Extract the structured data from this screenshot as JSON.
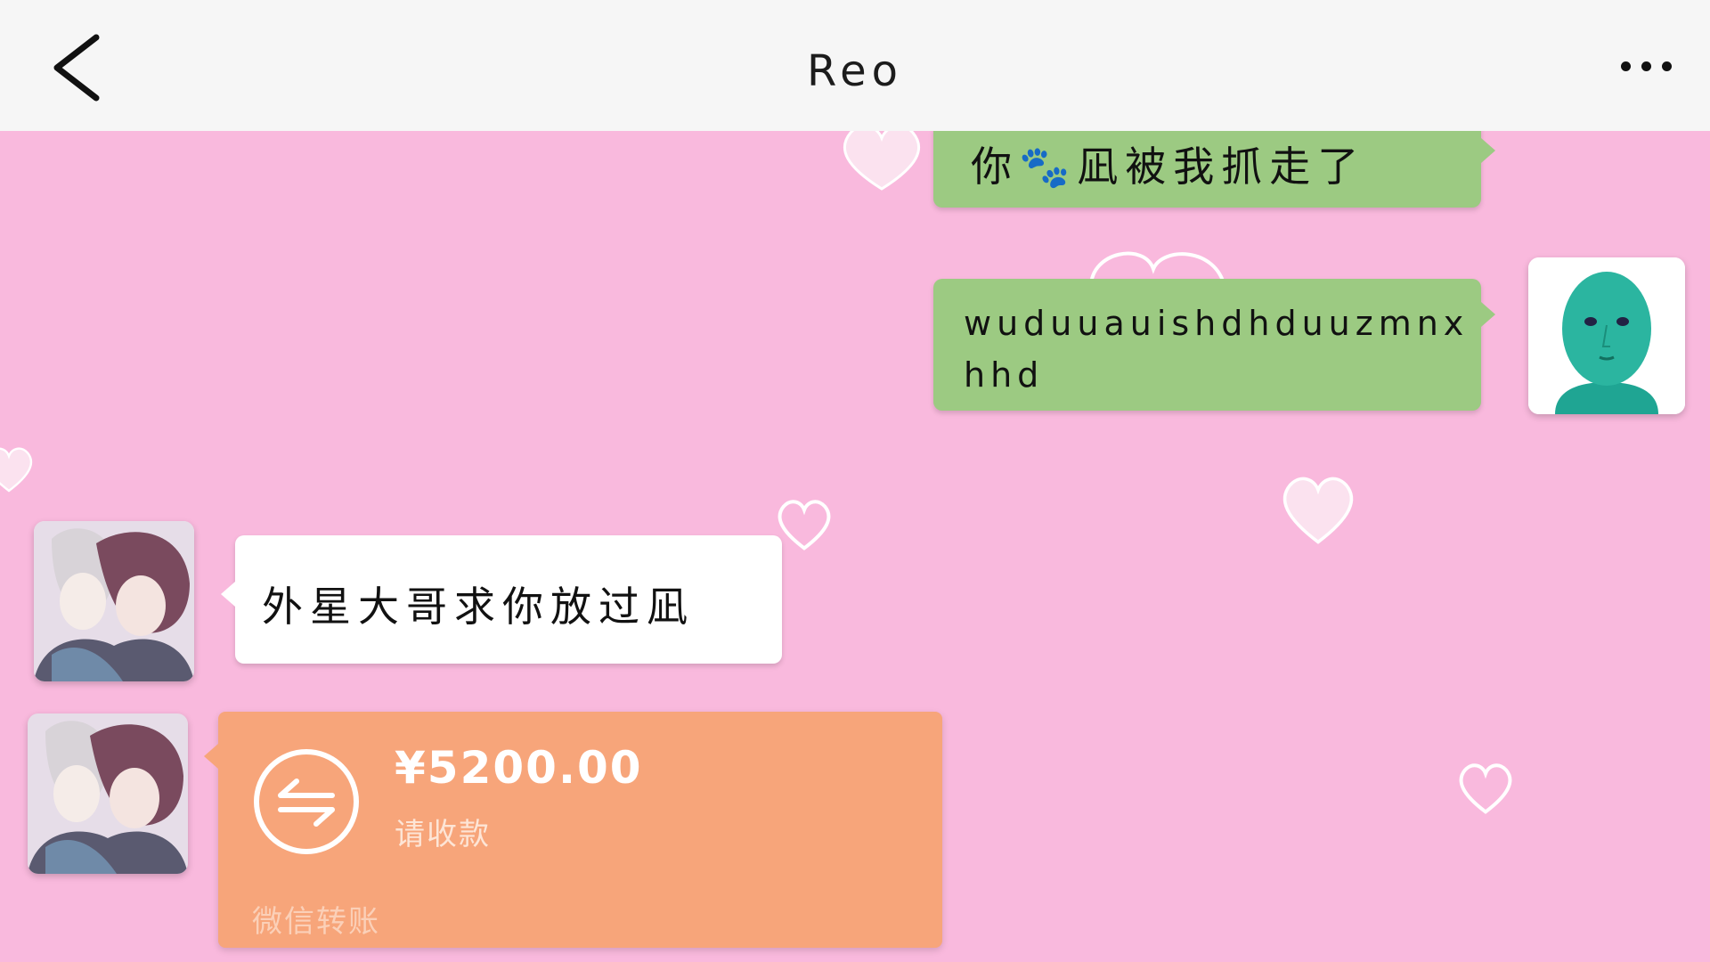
{
  "header": {
    "title": "Reo",
    "back_icon": "chevron-left-icon",
    "more_icon": "more-dots-icon"
  },
  "messages": [
    {
      "sender": "self",
      "text": "你🐾凪被我抓走了"
    },
    {
      "sender": "self",
      "text_line1": "wuduuauishdhduuzmnx",
      "text_line2": "hhd",
      "avatar_icon": "green-face-avatar"
    },
    {
      "sender": "other",
      "text": "外星大哥求你放过凪",
      "avatar_icon": "anime-couple-avatar"
    },
    {
      "sender": "other",
      "type": "transfer",
      "amount": "¥5200.00",
      "status": "请收款",
      "label": "微信转账",
      "icon": "transfer-arrows-icon",
      "avatar_icon": "anime-couple-avatar"
    }
  ],
  "colors": {
    "background": "#f9b9dd",
    "header": "#f6f6f6",
    "self_bubble": "#9cca82",
    "other_bubble": "#ffffff",
    "transfer": "#f7a57a"
  }
}
